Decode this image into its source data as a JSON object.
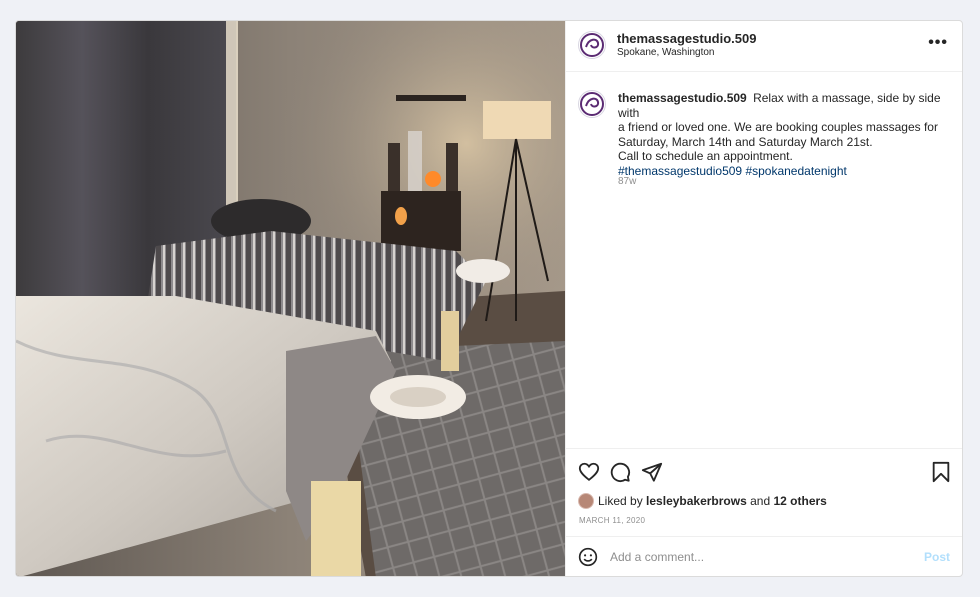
{
  "post": {
    "username": "themassagestudio.509",
    "location": "Spokane, Washington",
    "more_icon": "more-horizontal-icon",
    "caption": {
      "first_line": "Relax with a massage, side by side with",
      "lines": [
        "a friend or loved one. We are booking couples massages for",
        "Saturday, March 14th and Saturday March 21st.",
        "Call to schedule an appointment."
      ],
      "hashtags": [
        "#themassagestudio509",
        "#spokanedatenight"
      ]
    },
    "time_ago": "87w",
    "likes": {
      "prefix": "Liked by",
      "user": "lesleybakerbrows",
      "joiner": "and",
      "others": "12 others"
    },
    "date": "March 11, 2020",
    "comment": {
      "placeholder": "Add a comment...",
      "post_label": "Post"
    }
  },
  "icons": [
    "heart-icon",
    "comment-icon",
    "share-icon",
    "bookmark-icon",
    "emoji-icon"
  ],
  "colors": {
    "background": "#eff1f6",
    "hashtag": "#00376b",
    "post_button": "#b2dffc",
    "muted": "#8e8e8e",
    "logo": "#5b2b73"
  }
}
